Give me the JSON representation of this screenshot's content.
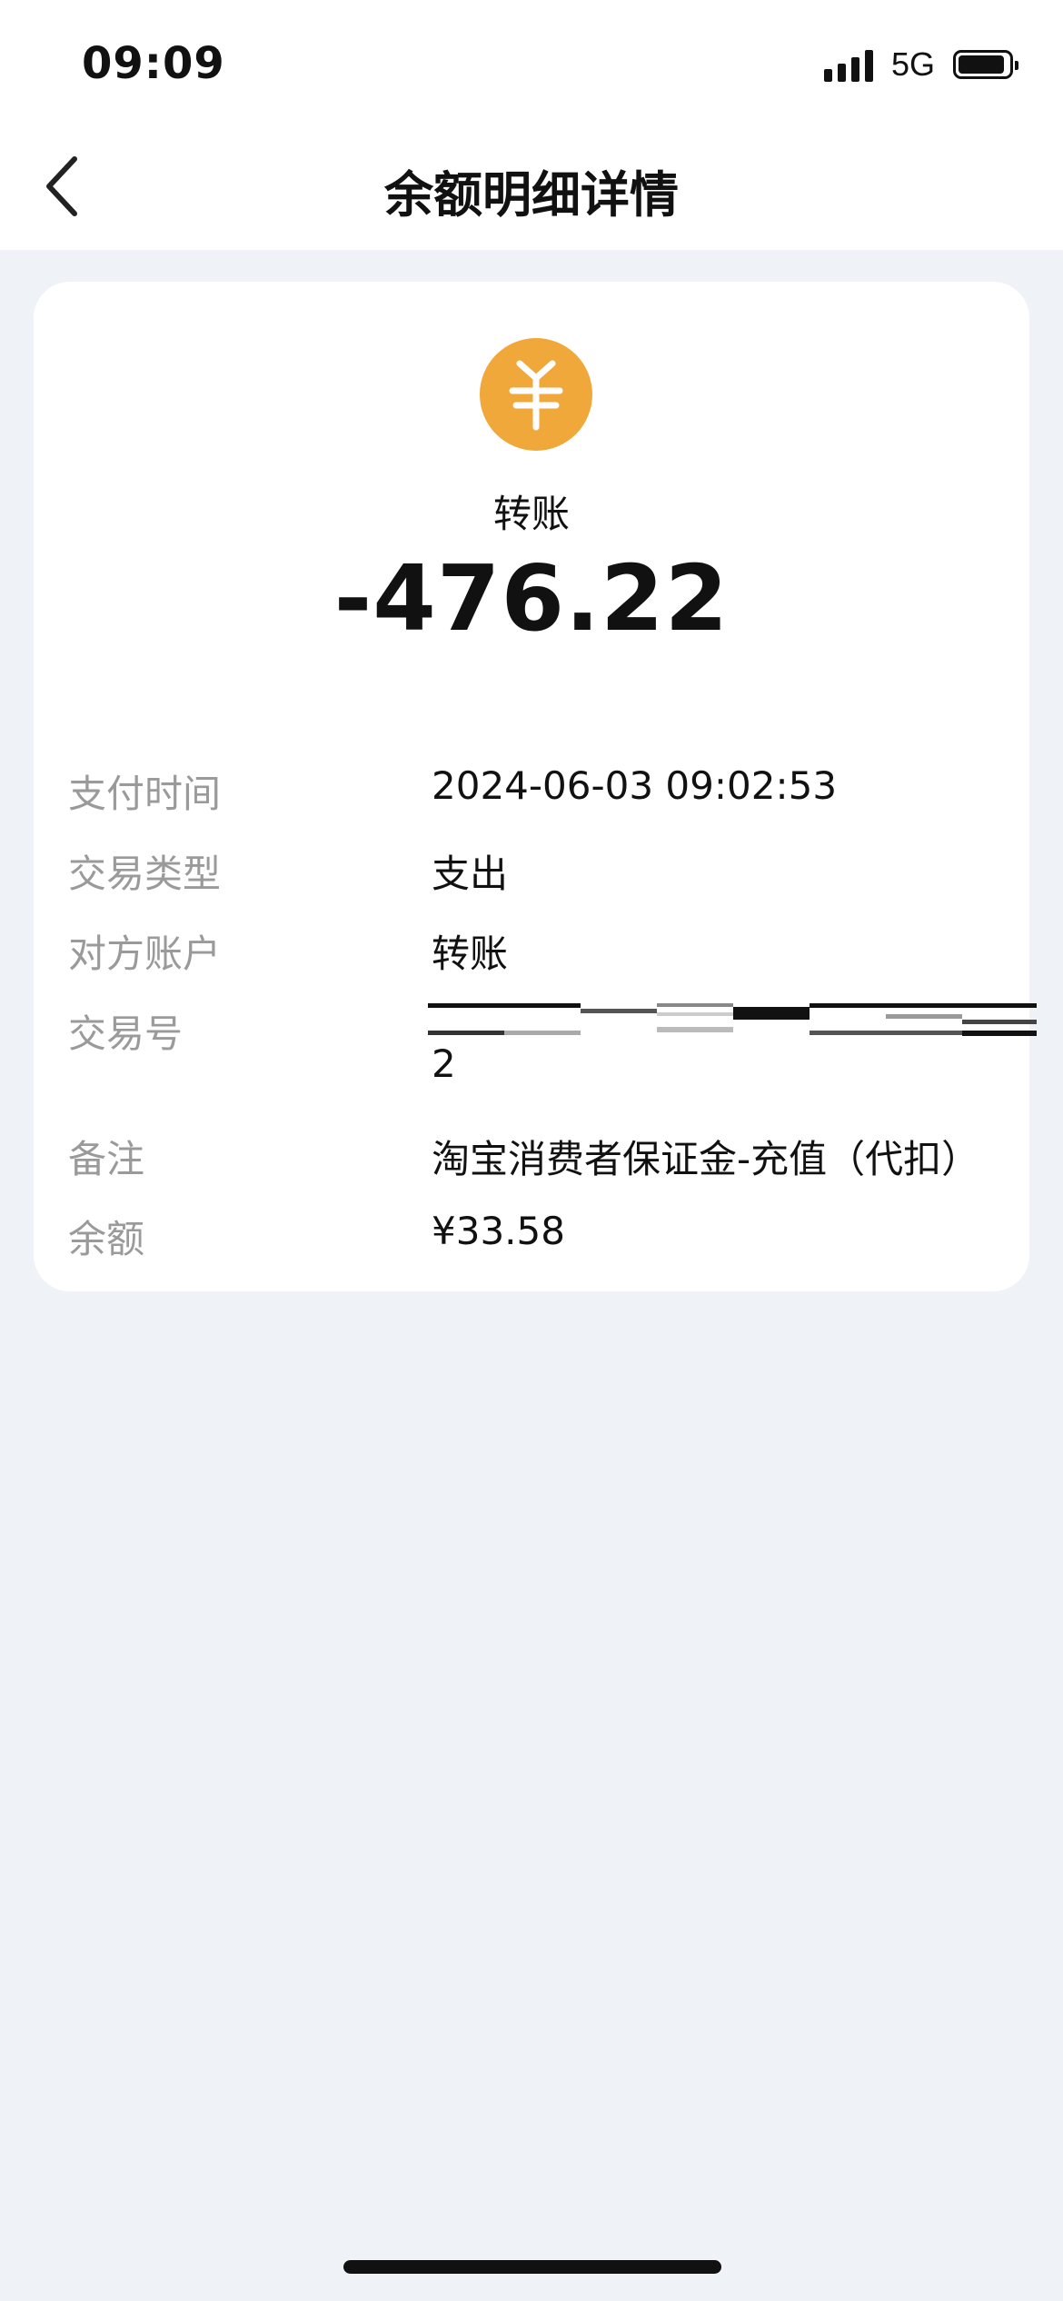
{
  "status_bar": {
    "time": "09:09",
    "network": "5G"
  },
  "nav": {
    "title": "余额明细详情",
    "back_icon": "chevron-left-icon"
  },
  "transaction": {
    "icon": "yuan-coin-icon",
    "icon_color": "#f0a83a",
    "type_title": "转账",
    "amount": "-476.22"
  },
  "details": [
    {
      "label": "支付时间",
      "value": "2024-06-03 09:02:53"
    },
    {
      "label": "交易类型",
      "value": "支出"
    },
    {
      "label": "对方账户",
      "value": "转账"
    },
    {
      "label": "交易号",
      "value": "2"
    },
    {
      "label": "备注",
      "value": "淘宝消费者保证金-充值（代扣）"
    },
    {
      "label": "余额",
      "value": "¥33.58"
    }
  ]
}
